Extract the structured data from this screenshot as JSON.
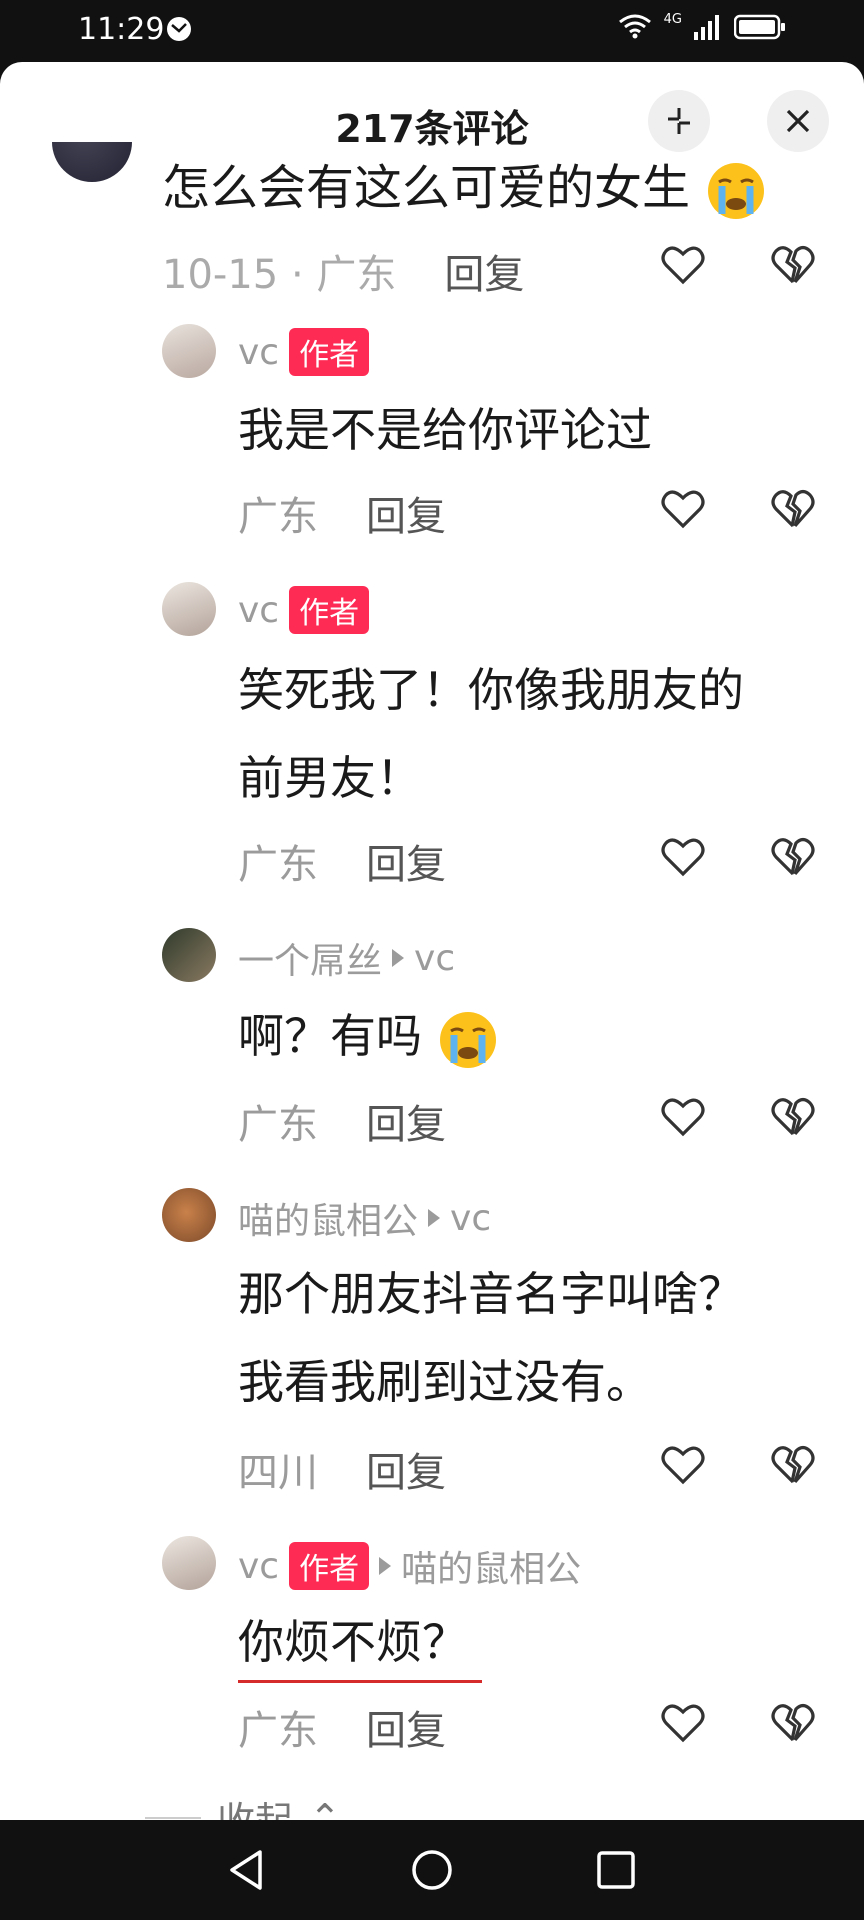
{
  "status": {
    "time": "11:29",
    "network": "4G"
  },
  "header": {
    "title": "217条评论"
  },
  "top_comment": {
    "text": "怎么会有这么可爱的女生",
    "date_location": "10-15 · 广东",
    "reply": "回复"
  },
  "replies": [
    {
      "name": "vc",
      "badge": "作者",
      "text": "我是不是给你评论过",
      "location": "广东",
      "reply": "回复"
    },
    {
      "name": "vc",
      "badge": "作者",
      "text_line1": "笑死我了！你像我朋友的",
      "text_line2": "前男友！",
      "location": "广东",
      "reply": "回复"
    },
    {
      "name": "一个屌丝",
      "target": "vc",
      "text": "啊？有吗",
      "location": "广东",
      "reply": "回复"
    },
    {
      "name": "喵的鼠相公",
      "target": "vc",
      "text_line1": "那个朋友抖音名字叫啥？",
      "text_line2": "我看我刷到过没有。",
      "location": "四川",
      "reply": "回复"
    },
    {
      "name": "vc",
      "badge": "作者",
      "target": "喵的鼠相公",
      "text": "你烦不烦？",
      "location": "广东",
      "reply": "回复"
    }
  ],
  "collapse": {
    "label": "收起"
  },
  "colors": {
    "badge": "#fe2c55",
    "underline": "#d62b2b",
    "meta": "#9b9b9b"
  }
}
